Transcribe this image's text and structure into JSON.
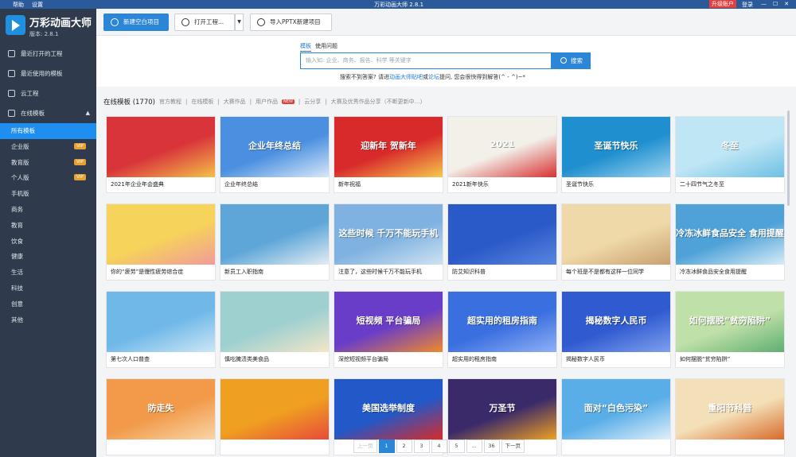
{
  "titlebar": {
    "menu": [
      "帮助",
      "设置"
    ],
    "title": "万彩动画大师 2.8.1",
    "upgrade": "升级账户",
    "login": "登录",
    "controls": [
      "—",
      "☐",
      "✕"
    ]
  },
  "app": {
    "name": "万彩动画大师",
    "version": "版本: 2.8.1"
  },
  "sidebar": {
    "items": [
      {
        "label": "最近打开的工程",
        "icon": "clock-icon"
      },
      {
        "label": "最近使用的模板",
        "icon": "template-icon"
      },
      {
        "label": "云工程",
        "icon": "cloud-icon"
      },
      {
        "label": "在线模板",
        "icon": "cloud-icon",
        "arrow": "▲"
      }
    ],
    "categories": [
      {
        "label": "所有模板",
        "active": true,
        "vip": ""
      },
      {
        "label": "企业版",
        "vip": "VIP"
      },
      {
        "label": "教育版",
        "vip": "VIP"
      },
      {
        "label": "个人版",
        "vip": "VIP"
      },
      {
        "label": "手机版",
        "vip": ""
      },
      {
        "label": "商务",
        "vip": ""
      },
      {
        "label": "教育",
        "vip": ""
      },
      {
        "label": "饮食",
        "vip": ""
      },
      {
        "label": "健康",
        "vip": ""
      },
      {
        "label": "生活",
        "vip": ""
      },
      {
        "label": "科技",
        "vip": ""
      },
      {
        "label": "创意",
        "vip": ""
      },
      {
        "label": "其他",
        "vip": ""
      }
    ]
  },
  "toolbar": {
    "new_project": "新建空白项目",
    "open_project": "打开工程...",
    "import_pptx": "导入PPTX新建项目",
    "dropdown": "▼"
  },
  "search": {
    "tabs": [
      "模板",
      "使用问题"
    ],
    "placeholder": "输入如: 企业、商务、报告、科学 等关键字",
    "button": "搜索",
    "hint_pre": "搜索不到答案? 请进",
    "hint_link1": "动画大师贴吧",
    "hint_mid": "或",
    "hint_link2": "论坛",
    "hint_post": "提问, 您会很快得到解答(^ - ^)~*"
  },
  "section": {
    "title": "在线模板 (1770)",
    "filters": [
      "官方教程",
      "在线模板",
      "大赛作品",
      "用户作品",
      "云分享",
      "大赛及优秀作品分享（不断更新中…）"
    ],
    "new_badge": "NEW"
  },
  "cards": [
    {
      "caption": "2021年企业年会盛典",
      "bg": "#d8343a",
      "bg2": "#f4c04a",
      "thumb_text": ""
    },
    {
      "caption": "企业年终总结",
      "bg": "#4a8fe0",
      "bg2": "#d8e8f8",
      "thumb_text": "企业年终总结"
    },
    {
      "caption": "新年祝福",
      "bg": "#d82a2a",
      "bg2": "#f7c94d",
      "thumb_text": "迎新年 贺新年"
    },
    {
      "caption": "2021新年快乐",
      "bg": "#f3f0ea",
      "bg2": "#d83030",
      "thumb_text": "2021"
    },
    {
      "caption": "圣诞节快乐",
      "bg": "#1f8fcf",
      "bg2": "#9fd4f0",
      "thumb_text": "圣诞节快乐"
    },
    {
      "caption": "二十四节气之冬至",
      "bg": "#bfe6f5",
      "bg2": "#6ec0e4",
      "thumb_text": "冬至"
    },
    {
      "caption": "你的“疲劳”是慢性疲劳综合症",
      "bg": "#f6d35a",
      "bg2": "#f19a9a",
      "thumb_text": ""
    },
    {
      "caption": "新员工入职指南",
      "bg": "#5ea6d8",
      "bg2": "#e4edf3",
      "thumb_text": ""
    },
    {
      "caption": "注意了，这些时候千万不能玩手机",
      "bg": "#7fb2e0",
      "bg2": "#cfe2f2",
      "thumb_text": "这些时候 千万不能玩手机"
    },
    {
      "caption": "防艾知识科普",
      "bg": "#2a59c8",
      "bg2": "#5a86e0",
      "thumb_text": ""
    },
    {
      "caption": "每个班是不是都有这样一位同学",
      "bg": "#f0d9a8",
      "bg2": "#c8a070",
      "thumb_text": ""
    },
    {
      "caption": "冷冻冰鲜食品安全食用提醒",
      "bg": "#4fa2d8",
      "bg2": "#d7ecf7",
      "thumb_text": "冷冻冰鲜食品安全 食用提醒"
    },
    {
      "caption": "第七次人口普查",
      "bg": "#6fb8e8",
      "bg2": "#cde6f6",
      "thumb_text": ""
    },
    {
      "caption": "慎吃腌渍类美食品",
      "bg": "#9fd0d0",
      "bg2": "#f3e6c8",
      "thumb_text": ""
    },
    {
      "caption": "深挖短视频平台骗局",
      "bg": "#6a3dc8",
      "bg2": "#f08a2a",
      "thumb_text": "短视频 平台骗局"
    },
    {
      "caption": "超实用的租房指南",
      "bg": "#3a6fe0",
      "bg2": "#8fb0f5",
      "thumb_text": "超实用的租房指南"
    },
    {
      "caption": "揭秘数字人民币",
      "bg": "#2f5ad0",
      "bg2": "#7fa0ee",
      "thumb_text": "揭秘数字人民币"
    },
    {
      "caption": "如何摆脱“贫穷陷阱”",
      "bg": "#bfe0a8",
      "bg2": "#5fae70",
      "thumb_text": "如何摆脱“贫穷陷阱”"
    },
    {
      "caption": "",
      "bg": "#f29a4a",
      "bg2": "#f8d6a8",
      "thumb_text": "防走失"
    },
    {
      "caption": "",
      "bg": "#f0a020",
      "bg2": "#e84a3a",
      "thumb_text": ""
    },
    {
      "caption": "",
      "bg": "#2258c8",
      "bg2": "#d82a2a",
      "thumb_text": "美国选举制度"
    },
    {
      "caption": "",
      "bg": "#3a2a6a",
      "bg2": "#f0a020",
      "thumb_text": "万圣节"
    },
    {
      "caption": "",
      "bg": "#5aaee8",
      "bg2": "#e0f0fa",
      "thumb_text": "面对“白色污染”"
    },
    {
      "caption": "",
      "bg": "#f4e0b8",
      "bg2": "#d86a2a",
      "thumb_text": "重阳节科普"
    }
  ],
  "pager": {
    "prev": "上一页",
    "pages": [
      "1",
      "2",
      "3",
      "4",
      "5",
      "...",
      "36"
    ],
    "next": "下一页"
  }
}
